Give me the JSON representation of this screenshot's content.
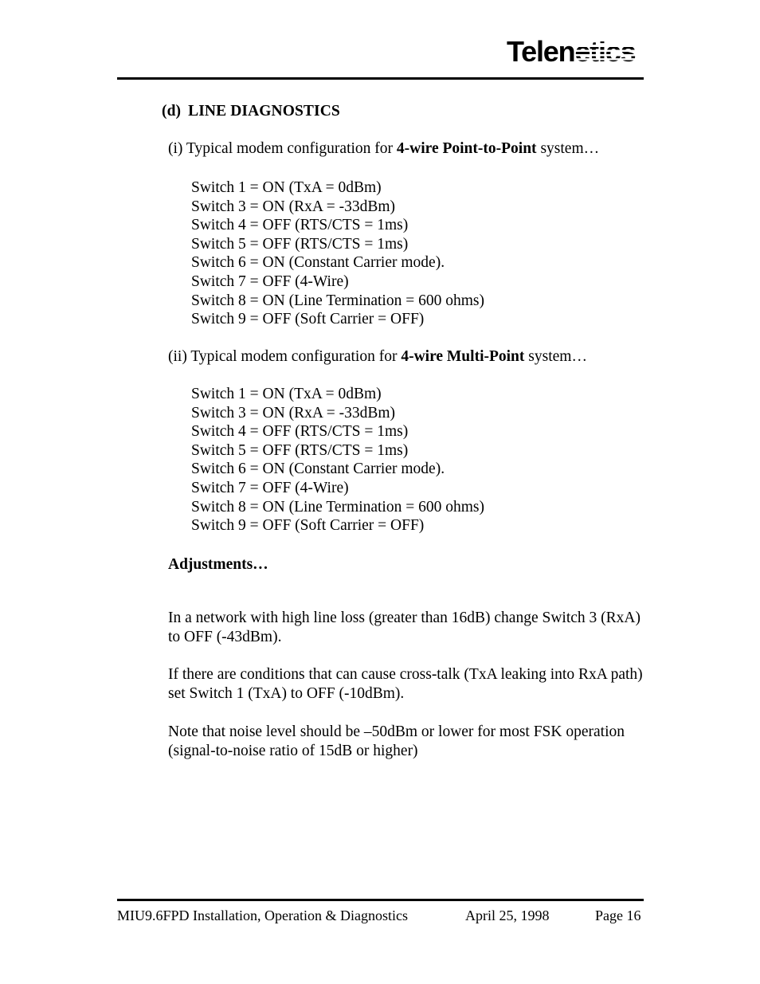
{
  "header": {
    "logo_text": "Telenetics",
    "logo_name": "telenetics-logo"
  },
  "section": {
    "label": "(d)",
    "title": "LINE DIAGNOSTICS"
  },
  "subsections": [
    {
      "marker": "(i)",
      "intro_before": " Typical modem configuration for ",
      "intro_bold": "4-wire Point-to-Point",
      "intro_after": " system…",
      "switches": [
        "Switch 1 = ON (TxA = 0dBm)",
        "Switch 3 = ON (RxA = -33dBm)",
        "Switch 4 = OFF (RTS/CTS = 1ms)",
        "Switch 5 = OFF (RTS/CTS = 1ms)",
        "Switch 6 = ON (Constant Carrier mode).",
        "Switch 7 = OFF (4-Wire)",
        "Switch 8 = ON (Line Termination = 600 ohms)",
        "Switch 9 = OFF (Soft Carrier = OFF)"
      ]
    },
    {
      "marker": "(ii)",
      "intro_before": " Typical modem configuration for ",
      "intro_bold": "4-wire Multi-Point",
      "intro_after": " system…",
      "switches": [
        "Switch 1 = ON (TxA = 0dBm)",
        "Switch 3 = ON (RxA = -33dBm)",
        "Switch 4 = OFF (RTS/CTS = 1ms)",
        "Switch 5 = OFF (RTS/CTS = 1ms)",
        "Switch 6 = ON (Constant Carrier mode).",
        "Switch 7 = OFF (4-Wire)",
        "Switch 8 = ON (Line Termination = 600 ohms)",
        "Switch 9 = OFF (Soft Carrier = OFF)"
      ]
    }
  ],
  "adjustments": {
    "heading": "Adjustments…",
    "paragraphs": [
      "In a network with high line loss (greater than 16dB) change Switch 3 (RxA) to OFF (-43dBm).",
      "If there are conditions that can cause cross-talk (TxA leaking into RxA path) set Switch 1 (TxA) to OFF (-10dBm).",
      "Note that noise level should be –50dBm or lower for most FSK operation (signal-to-noise ratio of 15dB or higher)"
    ]
  },
  "footer": {
    "title": "MIU9.6FPD Installation, Operation & Diagnostics",
    "date": "April 25, 1998",
    "page": "Page 16"
  }
}
